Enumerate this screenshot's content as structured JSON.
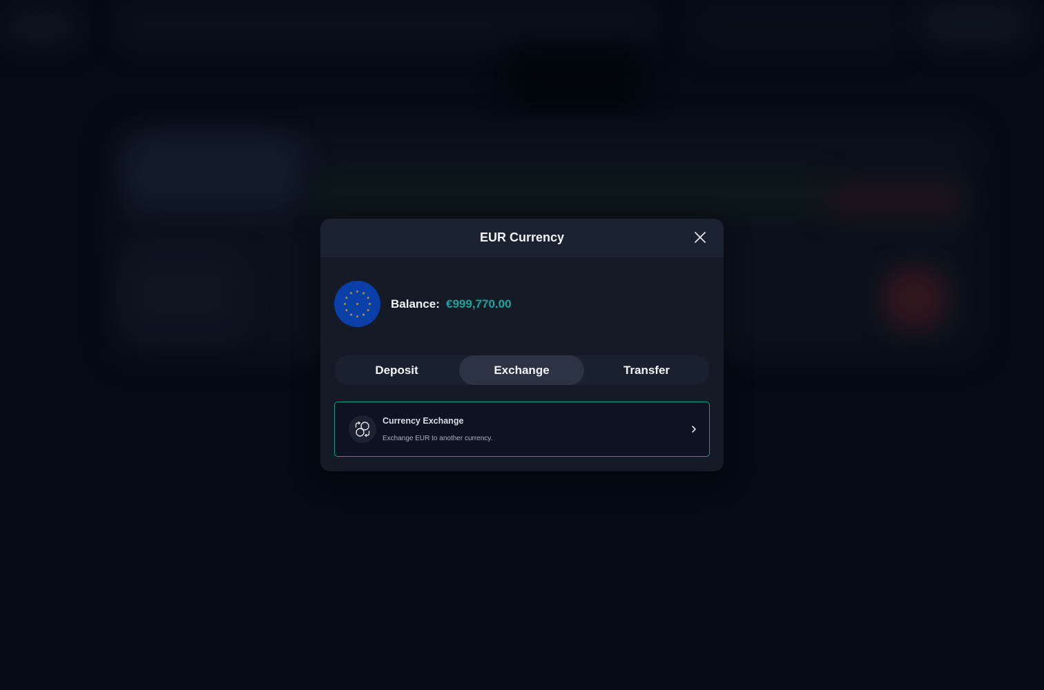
{
  "modal": {
    "title": "EUR Currency",
    "close_icon": "close-icon"
  },
  "balance": {
    "label": "Balance:",
    "value": "€999,770.00",
    "flag_icon": "eu-flag-icon"
  },
  "tabs": [
    {
      "label": "Deposit",
      "active": false
    },
    {
      "label": "Exchange",
      "active": true
    },
    {
      "label": "Transfer",
      "active": false
    }
  ],
  "option": {
    "title": "Currency Exchange",
    "description": "Exchange EUR to another currency.",
    "icon": "currency-exchange-icon",
    "chevron_icon": "chevron-right-icon"
  },
  "colors": {
    "accent": "#1fa39a",
    "flag_blue": "#0b3fa8",
    "flag_stars": "#f5c518"
  }
}
